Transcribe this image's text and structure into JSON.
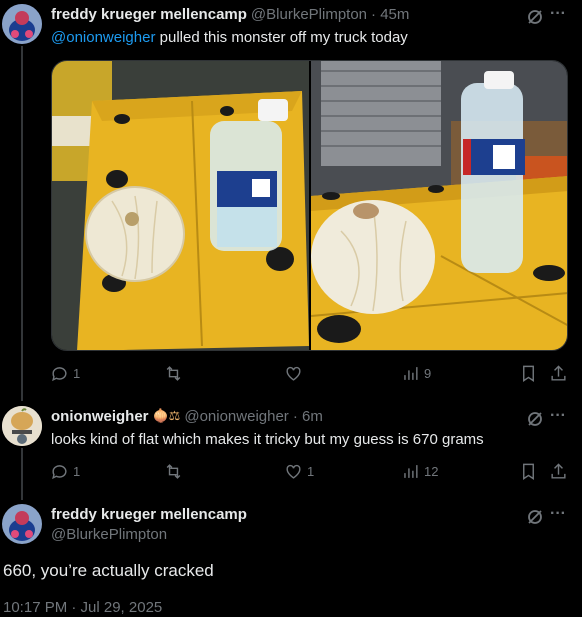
{
  "tweet1": {
    "display_name": "freddy krueger mellencamp",
    "handle": "@BlurkePlimpton",
    "time": "· 45m",
    "mention": "@onionweigher",
    "text": " pulled this monster off my truck today",
    "stats": {
      "replies": "1",
      "likes": "",
      "views": "9"
    }
  },
  "tweet2": {
    "display_name": "onionweigher",
    "emojis": "🧅⚖",
    "handle": "@onionweigher",
    "time": "· 6m",
    "text": "looks kind of flat which makes it tricky but my guess is 670 grams",
    "stats": {
      "replies": "1",
      "likes": "1",
      "views": "12"
    }
  },
  "tweet3": {
    "display_name": "freddy krueger mellencamp",
    "handle": "@BlurkePlimpton",
    "text": "660, you’re actually cracked",
    "timestamp": "10:17 PM · Jul 29, 2025"
  },
  "icons": {
    "more": "more-icon",
    "grok": "grok-icon",
    "reply": "reply-icon",
    "retweet": "retweet-icon",
    "like": "like-icon",
    "views": "views-icon",
    "bookmark": "bookmark-icon",
    "share": "share-icon"
  },
  "colors": {
    "accent": "#1d9bf0",
    "muted": "#71767b",
    "box_yellow": "#e8b422"
  }
}
